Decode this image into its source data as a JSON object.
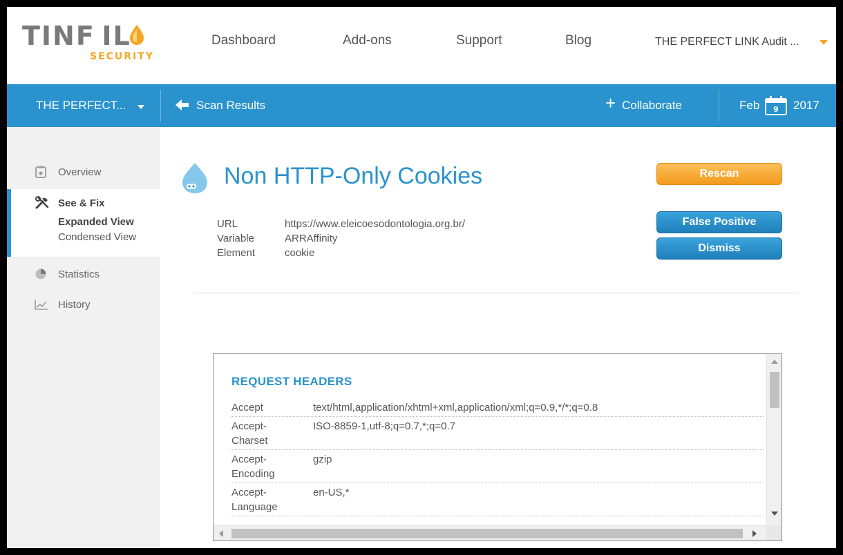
{
  "brand": {
    "logo_word": "TINF IL",
    "logo_sub": "SECURITY",
    "accent": "#2a93ce",
    "orange": "#f4a623"
  },
  "topnav": {
    "links": [
      "Dashboard",
      "Add-ons",
      "Support",
      "Blog"
    ],
    "account": "THE PERFECT LINK Audit ..."
  },
  "bluebar": {
    "project": "THE PERFECT...",
    "back_label": "Scan Results",
    "collaborate": "Collaborate",
    "month": "Feb",
    "day": "9",
    "year": "2017"
  },
  "sidebar": {
    "overview": "Overview",
    "see_fix": "See & Fix",
    "expanded": "Expanded View",
    "condensed": "Condensed View",
    "statistics": "Statistics",
    "history": "History"
  },
  "vuln": {
    "title": "Non HTTP-Only Cookies",
    "meta": [
      {
        "key": "URL",
        "value": "https://www.eleicoesodontologia.org.br/"
      },
      {
        "key": "Variable",
        "value": "ARRAffinity"
      },
      {
        "key": "Element",
        "value": "cookie"
      }
    ]
  },
  "actions": {
    "rescan": "Rescan",
    "false_positive": "False Positive",
    "dismiss": "Dismiss"
  },
  "request_headers": {
    "title": "REQUEST HEADERS",
    "rows": [
      {
        "key": "Accept",
        "value": "text/html,application/xhtml+xml,application/xml;q=0.9,*/*;q=0.8"
      },
      {
        "key": "Accept-\nCharset",
        "value": "ISO-8859-1,utf-8;q=0.7,*;q=0.7"
      },
      {
        "key": "Accept-\nEncoding",
        "value": "gzip"
      },
      {
        "key": "Accept-\nLanguage",
        "value": "en-US,*"
      }
    ]
  }
}
